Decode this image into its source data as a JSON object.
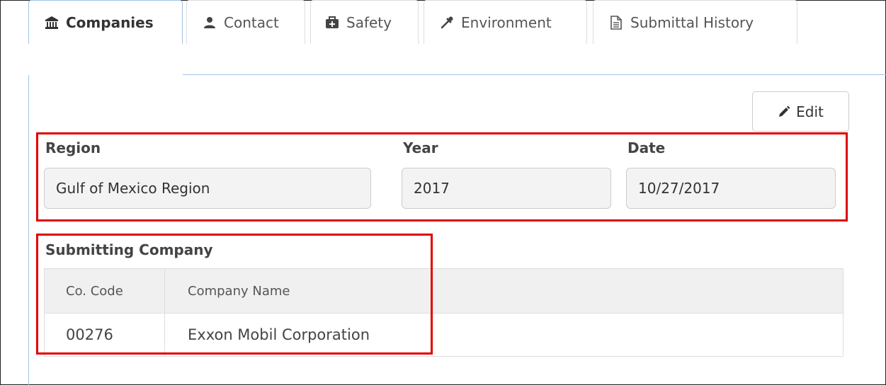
{
  "tabs": [
    {
      "label": "Companies",
      "icon": "bank-icon",
      "active": true
    },
    {
      "label": "Contact",
      "icon": "user-icon",
      "active": false
    },
    {
      "label": "Safety",
      "icon": "medkit-icon",
      "active": false
    },
    {
      "label": "Environment",
      "icon": "eyedropper-icon",
      "active": false
    },
    {
      "label": "Submittal History",
      "icon": "document-icon",
      "active": false
    }
  ],
  "toolbar": {
    "edit_label": "Edit"
  },
  "form": {
    "region": {
      "label": "Region",
      "value": "Gulf of Mexico Region"
    },
    "year": {
      "label": "Year",
      "value": "2017"
    },
    "date": {
      "label": "Date",
      "value": "10/27/2017"
    }
  },
  "submitting_company": {
    "title": "Submitting Company",
    "columns": [
      "Co. Code",
      "Company Name"
    ],
    "rows": [
      {
        "code": "00276",
        "name": "Exxon Mobil Corporation"
      }
    ]
  },
  "colors": {
    "accent_border": "#9ec3e6",
    "highlight": "#e00000"
  }
}
